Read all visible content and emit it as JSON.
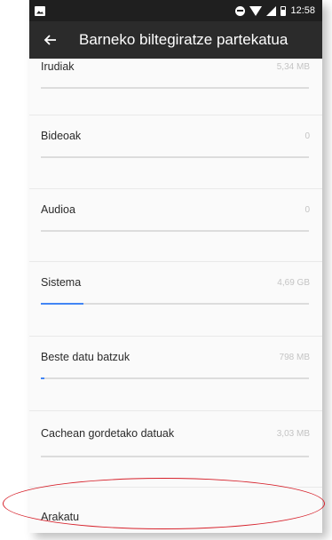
{
  "statusbar": {
    "time": "12:58"
  },
  "appbar": {
    "title": "Barneko biltegiratze partekatua"
  },
  "items": [
    {
      "label": "Irudiak",
      "size": "5,34 MB",
      "fill": 0.0
    },
    {
      "label": "Bideoak",
      "size": "0",
      "fill": 0.0
    },
    {
      "label": "Audioa",
      "size": "0",
      "fill": 0.0
    },
    {
      "label": "Sistema",
      "size": "4,69 GB",
      "fill": 0.16
    },
    {
      "label": "Beste datu batzuk",
      "size": "798 MB",
      "fill": 0.01
    },
    {
      "label": "Cachean gordetako datuak",
      "size": "3,03 MB",
      "fill": 0.0
    }
  ],
  "browse": {
    "label": "Arakatu"
  },
  "colors": {
    "accent": "#4285f4",
    "appbar": "#2b2b2b",
    "annotation": "#d6202a"
  }
}
